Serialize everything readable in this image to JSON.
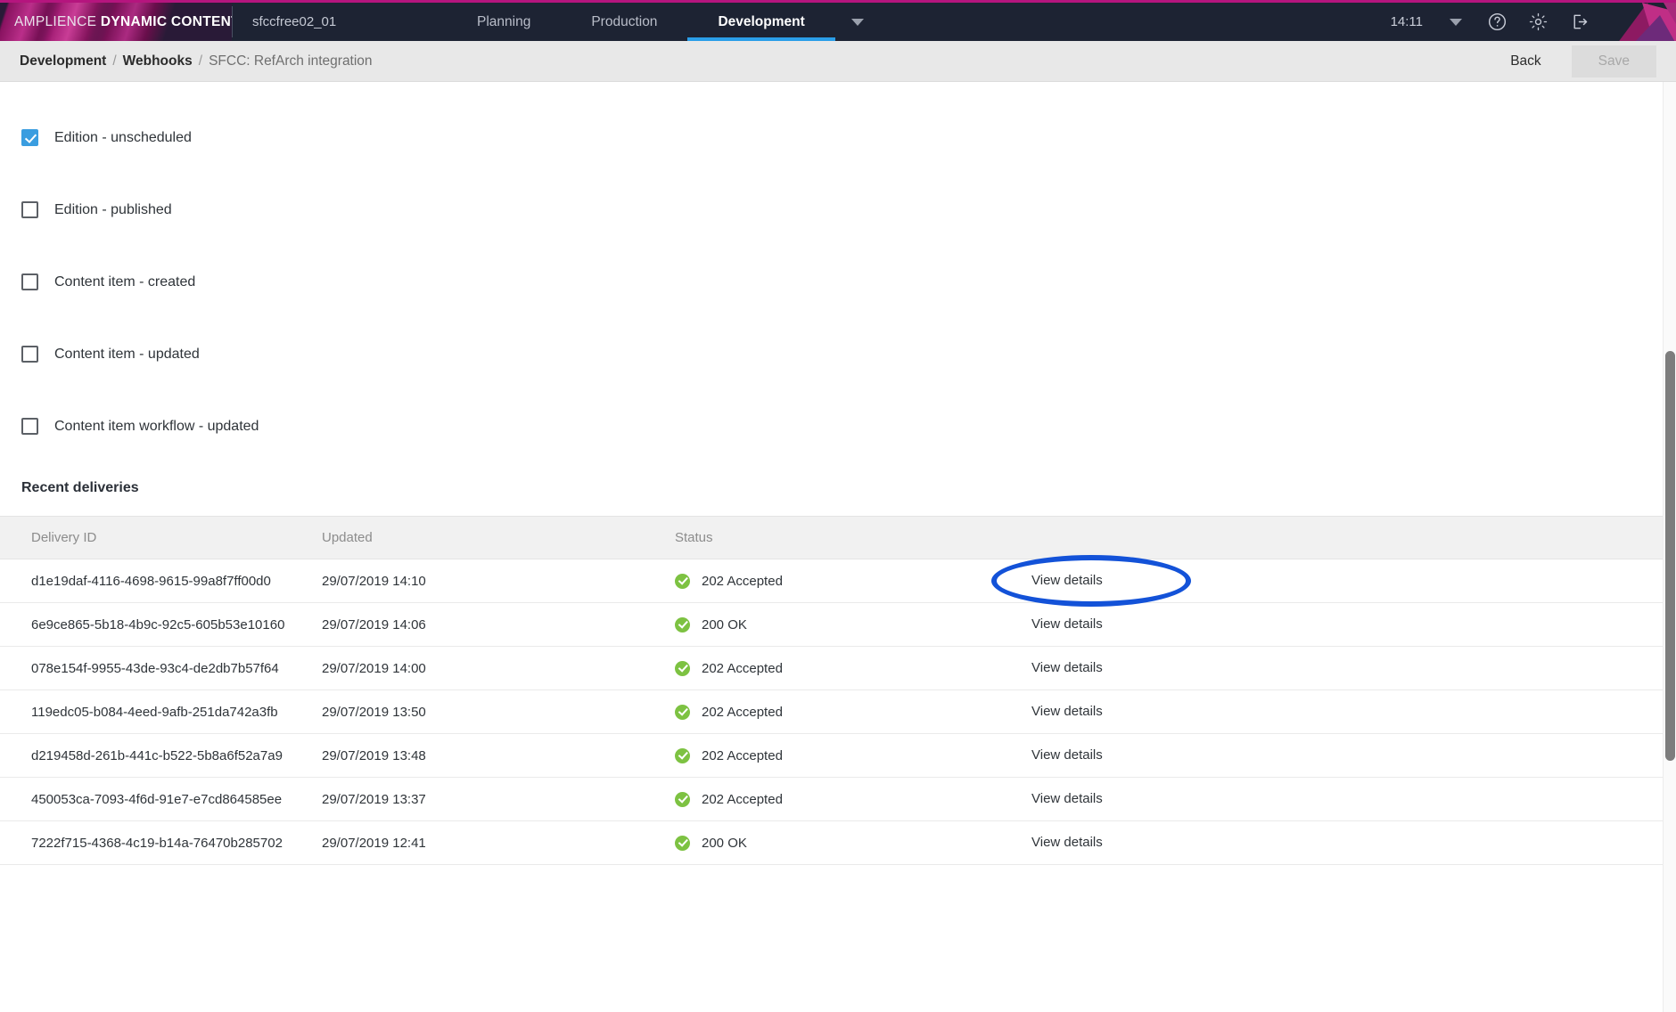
{
  "topbar": {
    "brand_light": "AMPLIENCE ",
    "brand_bold": "DYNAMIC CONTENT",
    "account": "sfccfree02_01",
    "tabs": [
      {
        "label": "Planning",
        "active": false
      },
      {
        "label": "Production",
        "active": false
      },
      {
        "label": "Development",
        "active": true
      }
    ],
    "caret_icon": "chevron-down-icon",
    "clock": "14:11",
    "user_caret_icon": "chevron-down-icon",
    "help_icon": "question-circle-icon",
    "settings_icon": "gear-icon",
    "logout_icon": "logout-icon",
    "accent_color": "#2a9ee8",
    "brand_color": "#b5157e",
    "bar_color": "#1d2333"
  },
  "breadcrumb": {
    "root": "Development",
    "sep": "/",
    "section": "Webhooks",
    "current": "SFCC: RefArch integration"
  },
  "actions": {
    "back_label": "Back",
    "save_label": "Save",
    "save_disabled": true
  },
  "events": {
    "items": [
      {
        "label": "Edition - unscheduled",
        "checked": true
      },
      {
        "label": "Edition - published",
        "checked": false
      },
      {
        "label": "Content item - created",
        "checked": false
      },
      {
        "label": "Content item - updated",
        "checked": false
      },
      {
        "label": "Content item workflow - updated",
        "checked": false
      }
    ]
  },
  "deliveries": {
    "title": "Recent deliveries",
    "columns": [
      "Delivery ID",
      "Updated",
      "Status",
      ""
    ],
    "action_label": "View details",
    "status_icon": "check-circle-icon",
    "status_color": "#7dc242",
    "annotation_color": "#1352d8",
    "rows": [
      {
        "id": "d1e19daf-4116-4698-9615-99a8f7ff00d0",
        "updated": "29/07/2019 14:10",
        "status": "202 Accepted",
        "action": "View details",
        "highlighted": true
      },
      {
        "id": "6e9ce865-5b18-4b9c-92c5-605b53e10160",
        "updated": "29/07/2019 14:06",
        "status": "200 OK",
        "action": "View details",
        "highlighted": false
      },
      {
        "id": "078e154f-9955-43de-93c4-de2db7b57f64",
        "updated": "29/07/2019 14:00",
        "status": "202 Accepted",
        "action": "View details",
        "highlighted": false
      },
      {
        "id": "119edc05-b084-4eed-9afb-251da742a3fb",
        "updated": "29/07/2019 13:50",
        "status": "202 Accepted",
        "action": "View details",
        "highlighted": false
      },
      {
        "id": "d219458d-261b-441c-b522-5b8a6f52a7a9",
        "updated": "29/07/2019 13:48",
        "status": "202 Accepted",
        "action": "View details",
        "highlighted": false
      },
      {
        "id": "450053ca-7093-4f6d-91e7-e7cd864585ee",
        "updated": "29/07/2019 13:37",
        "status": "202 Accepted",
        "action": "View details",
        "highlighted": false
      },
      {
        "id": "7222f715-4368-4c19-b14a-76470b285702",
        "updated": "29/07/2019 12:41",
        "status": "200 OK",
        "action": "View details",
        "highlighted": false
      }
    ]
  }
}
